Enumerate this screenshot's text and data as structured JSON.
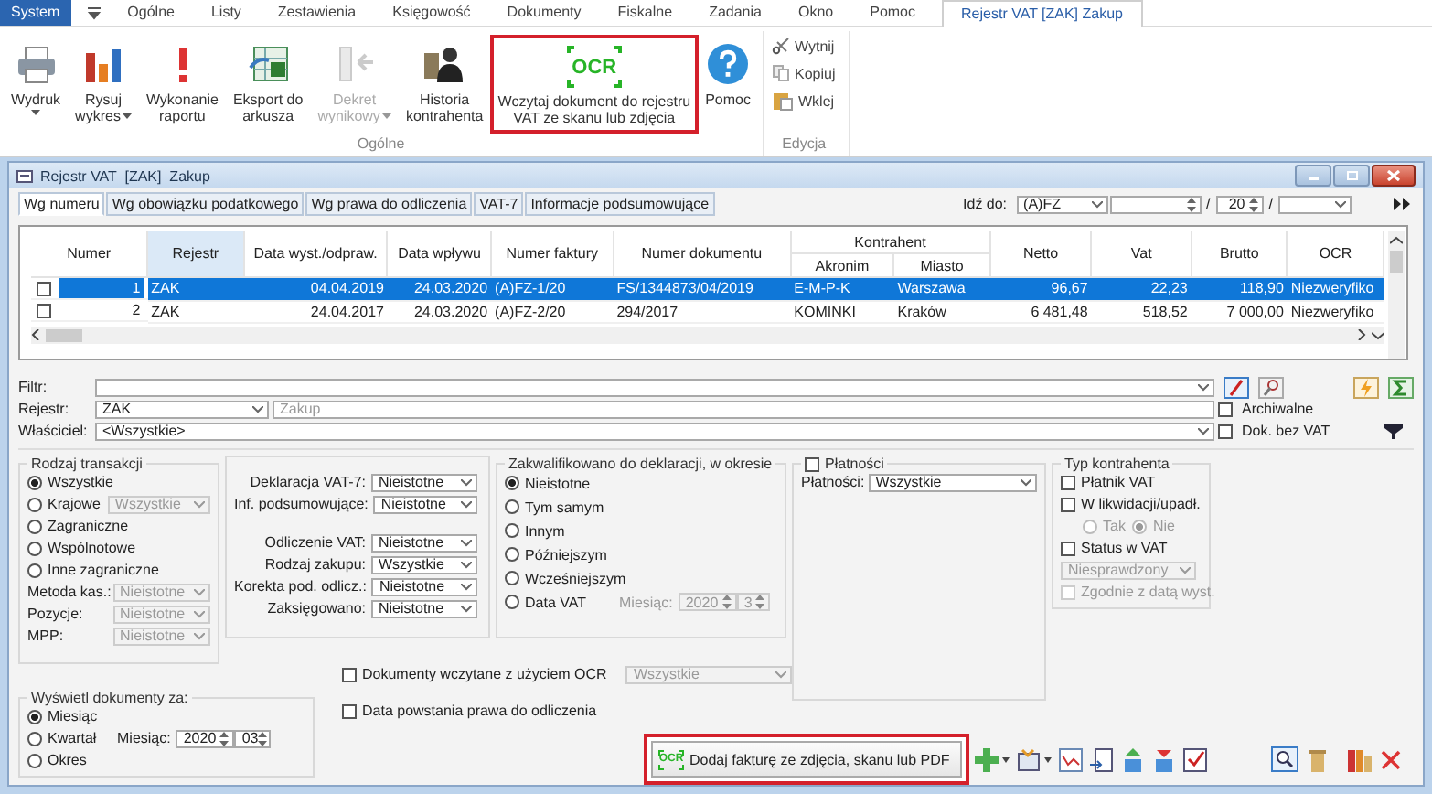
{
  "menu": [
    {
      "label": "System",
      "selected": true,
      "contextual": false
    },
    {
      "label": "Ogólne",
      "selected": false,
      "contextual": false
    },
    {
      "label": "Listy",
      "selected": false,
      "contextual": false
    },
    {
      "label": "Zestawienia",
      "selected": false,
      "contextual": false
    },
    {
      "label": "Księgowość",
      "selected": false,
      "contextual": false
    },
    {
      "label": "Dokumenty",
      "selected": false,
      "contextual": false
    },
    {
      "label": "Fiskalne",
      "selected": false,
      "contextual": false
    },
    {
      "label": "Zadania",
      "selected": false,
      "contextual": false
    },
    {
      "label": "Okno",
      "selected": false,
      "contextual": false
    },
    {
      "label": "Pomoc",
      "selected": false,
      "contextual": false
    },
    {
      "label": "Rejestr VAT  [ZAK]  Zakup",
      "selected": false,
      "contextual": true
    }
  ],
  "ribbon": {
    "groups": [
      {
        "label": "Ogólne",
        "buttons": [
          {
            "kind": "printer",
            "lines": [
              "Wydruk"
            ],
            "dropdown": true,
            "disabled": false,
            "highlighted": false
          },
          {
            "kind": "chart",
            "lines": [
              "Rysuj",
              "wykres"
            ],
            "dropdown": true,
            "disabled": false,
            "highlighted": false
          },
          {
            "kind": "alert",
            "lines": [
              "Wykonanie",
              "raportu"
            ],
            "dropdown": false,
            "disabled": false,
            "highlighted": false
          },
          {
            "kind": "sheet",
            "lines": [
              "Eksport do",
              "arkusza"
            ],
            "dropdown": false,
            "disabled": false,
            "highlighted": false
          },
          {
            "kind": "decree",
            "lines": [
              "Dekret",
              "wynikowy"
            ],
            "dropdown": true,
            "disabled": true,
            "highlighted": false
          },
          {
            "kind": "person",
            "lines": [
              "Historia",
              "kontrahenta"
            ],
            "dropdown": false,
            "disabled": false,
            "highlighted": false
          },
          {
            "kind": "ocr",
            "badge": "OCR",
            "lines": [
              "Wczytaj dokument do rejestru",
              "VAT ze skanu lub zdjęcia"
            ],
            "dropdown": false,
            "disabled": false,
            "highlighted": true
          },
          {
            "kind": "help",
            "lines": [
              "Pomoc"
            ],
            "dropdown": false,
            "disabled": false,
            "highlighted": false
          }
        ]
      },
      {
        "label": "Edycja",
        "small_buttons": [
          {
            "kind": "cut",
            "label": "Wytnij"
          },
          {
            "kind": "copy",
            "label": "Kopiuj"
          },
          {
            "kind": "paste",
            "label": "Wklej"
          }
        ]
      }
    ]
  },
  "window": {
    "title": "Rejestr VAT  [ZAK]  Zakup"
  },
  "tabs": [
    {
      "label": "Wg numeru",
      "selected": true
    },
    {
      "label": "Wg obowiązku podatkowego",
      "selected": false
    },
    {
      "label": "Wg prawa do odliczenia",
      "selected": false
    },
    {
      "label": "VAT-7",
      "selected": false
    },
    {
      "label": "Informacje podsumowujące",
      "selected": false
    }
  ],
  "goto": {
    "label": "Idź do:",
    "value": "(A)FZ",
    "year": "20",
    "separators": [
      "/",
      "/"
    ]
  },
  "table": {
    "columns": [
      {
        "label": "Numer",
        "sorted": false
      },
      {
        "label": "Rejestr",
        "sorted": true
      },
      {
        "label": "Data wyst./odpraw.",
        "sorted": false
      },
      {
        "label": "Data wpływu",
        "sorted": false
      },
      {
        "label": "Numer faktury",
        "sorted": false
      },
      {
        "label": "Numer dokumentu",
        "sorted": false
      },
      {
        "label": "Kontrahent",
        "sorted": false,
        "colspan": 2,
        "children": [
          {
            "label": "Akronim"
          },
          {
            "label": "Miasto"
          }
        ]
      },
      {
        "label": "Netto",
        "sorted": false
      },
      {
        "label": "Vat",
        "sorted": false
      },
      {
        "label": "Brutto",
        "sorted": false
      },
      {
        "label": "OCR",
        "sorted": false
      }
    ],
    "rows": [
      {
        "checked": false,
        "selected": true,
        "cells": [
          "1",
          "ZAK",
          "04.04.2019",
          "24.03.2020",
          "(A)FZ-1/20",
          "FS/1344873/04/2019",
          "E-M-P-K",
          "Warszawa",
          "96,67",
          "22,23",
          "118,90",
          "Niezweryfiko"
        ]
      },
      {
        "checked": false,
        "selected": false,
        "cells": [
          "2",
          "ZAK",
          "24.04.2017",
          "24.03.2020",
          "(A)FZ-2/20",
          "294/2017",
          "KOMINKI",
          "Kraków",
          "6 481,48",
          "518,52",
          "7 000,00",
          "Niezweryfiko"
        ]
      }
    ]
  },
  "filters": {
    "filter": {
      "label": "Filtr:"
    },
    "register": {
      "label": "Rejestr:",
      "value": "ZAK",
      "name": "Zakup"
    },
    "archived": {
      "label": "Archiwalne",
      "checked": false
    },
    "owner": {
      "label": "Właściciel:",
      "value": "<Wszystkie>"
    },
    "no_vat": {
      "label": "Dok. bez VAT",
      "checked": false
    }
  },
  "transaction": {
    "title": "Rodzaj transakcji",
    "options": [
      {
        "label": "Wszystkie",
        "selected": true
      },
      {
        "label": "Krajowe",
        "selected": false,
        "select": "Wszystkie"
      },
      {
        "label": "Zagraniczne",
        "selected": false
      },
      {
        "label": "Wspólnotowe",
        "selected": false
      },
      {
        "label": "Inne zagraniczne",
        "selected": false
      }
    ],
    "selects": [
      {
        "label": "Metoda kas.:",
        "value": "Nieistotne",
        "disabled": true
      },
      {
        "label": "Pozycje:",
        "value": "Nieistotne",
        "disabled": true
      },
      {
        "label": "MPP:",
        "value": "Nieistotne",
        "disabled": true
      }
    ]
  },
  "declaration": {
    "groups": [
      [
        {
          "label": "Deklaracja VAT-7:",
          "value": "Nieistotne"
        },
        {
          "label": "Inf. podsumowujące:",
          "value": "Nieistotne"
        }
      ],
      [
        {
          "label": "Odliczenie VAT:",
          "value": "Nieistotne"
        },
        {
          "label": "Rodzaj zakupu:",
          "value": "Wszystkie"
        },
        {
          "label": "Korekta pod. odlicz.:",
          "value": "Nieistotne"
        },
        {
          "label": "Zaksięgowano:",
          "value": "Nieistotne"
        }
      ]
    ]
  },
  "qualified": {
    "title": "Zakwalifikowano do deklaracji, w okresie",
    "options": [
      {
        "label": "Nieistotne",
        "selected": true
      },
      {
        "label": "Tym samym",
        "selected": false
      },
      {
        "label": "Innym",
        "selected": false
      },
      {
        "label": "Późniejszym",
        "selected": false
      },
      {
        "label": "Wcześniejszym",
        "selected": false
      },
      {
        "label": "Data VAT",
        "selected": false
      }
    ],
    "month": {
      "label": "Miesiąc:",
      "year": "2020",
      "month": "3",
      "disabled": true
    }
  },
  "payments": {
    "label": "Płatności",
    "checked": false,
    "select": {
      "label": "Płatności:",
      "value": "Wszystkie"
    }
  },
  "counterparty": {
    "title": "Typ kontrahenta",
    "payer": {
      "label": "Płatnik VAT",
      "checked": false
    },
    "liquidation": {
      "label": "W likwidacji/upadł.",
      "checked": false,
      "disabled": true,
      "options": [
        {
          "label": "Tak",
          "selected": false
        },
        {
          "label": "Nie",
          "selected": true
        }
      ]
    },
    "status": {
      "label": "Status w VAT",
      "checked": false,
      "value": "Niesprawdzony",
      "disabled": true
    },
    "by_date": {
      "label": "Zgodnie z datą wyst.",
      "checked": false,
      "disabled": true
    }
  },
  "period": {
    "title": "Wyświetl dokumenty za:",
    "options": [
      {
        "label": "Miesiąc",
        "selected": true
      },
      {
        "label": "Kwartał",
        "selected": false
      },
      {
        "label": "Okres",
        "selected": false
      }
    ],
    "month": {
      "label": "Miesiąc:",
      "year": "2020",
      "month": "03"
    }
  },
  "ocr_filter": {
    "label": "Dokumenty wczytane z użyciem OCR",
    "checked": false,
    "value": "Wszystkie",
    "disabled": true
  },
  "deduction_date": {
    "label": "Data powstania prawa do odliczenia",
    "checked": false
  },
  "add_button": {
    "badge": "OCR",
    "label": "Dodaj fakturę ze zdjęcia, skanu lub PDF",
    "highlighted": true
  }
}
